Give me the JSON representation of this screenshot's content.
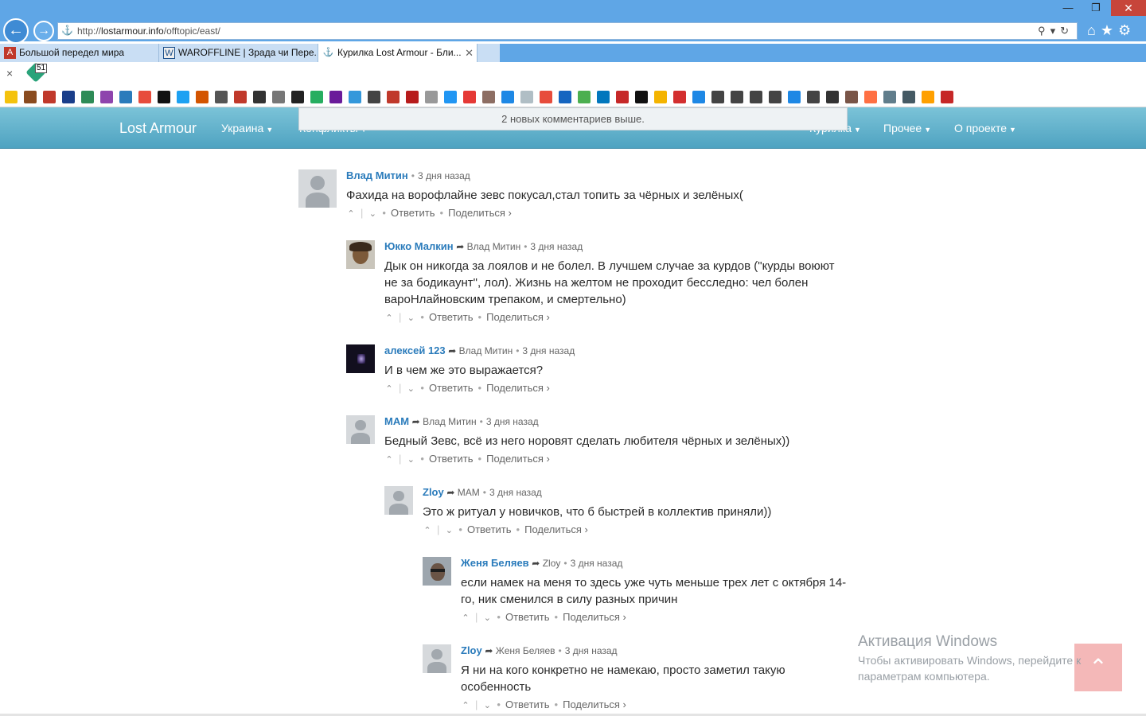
{
  "browser": {
    "url_prefix": "http://",
    "url_domain": "lostarmour.info",
    "url_path": "/offtopic/east/",
    "tabs": [
      {
        "label": "Большой передел мира"
      },
      {
        "label": "WAROFFLINE | Зрада чи Пере..."
      },
      {
        "label": "Курилка Lost Armour - Бли..."
      }
    ],
    "cmd_close": "×",
    "badge_count": "51"
  },
  "colors": {
    "chrome": "#5fa6e6",
    "nav": "#4fa3c1",
    "link": "#2a7bbb"
  },
  "site": {
    "brand": "Lost Armour",
    "nav_items": [
      "Украина",
      "Конфликты",
      "Курилка",
      "Прочее",
      "О проекте"
    ],
    "notification": "2 новых комментариев выше."
  },
  "labels": {
    "reply": "Ответить",
    "share": "Поделиться ›"
  },
  "comments": [
    {
      "author": "Влад Митин",
      "parent": "",
      "time": "3 дня назад",
      "text": "Фахида на ворофлайне зевс покусал,стал топить за чёрных и зелёных(",
      "avatar": "default"
    },
    {
      "author": "Юкко Малкин",
      "parent": "Влад Митин",
      "time": "3 дня назад",
      "text": "Дык он никогда за лоялов и не болел. В лучшем случае за курдов (\"курды воюют не за бодикаунт\", лол). Жизнь на желтом не проходит бесследно: чел болен вароНлайновским трепаком, и смертельно)",
      "avatar": "photo"
    },
    {
      "author": "алексей 123",
      "parent": "Влад Митин",
      "time": "3 дня назад",
      "text": "И в чем же это выражается?",
      "avatar": "photo"
    },
    {
      "author": "МАМ",
      "parent": "Влад Митин",
      "time": "3 дня назад",
      "text": "Бедный Зевс, всё из него норовят сделать любителя чёрных и зелёных))",
      "avatar": "default"
    },
    {
      "author": "Zloy",
      "parent": "МАМ",
      "time": "3 дня назад",
      "text": "Это ж ритуал у новичков, что б быстрей в коллектив приняли))",
      "avatar": "default"
    },
    {
      "author": "Женя Беляев",
      "parent": "Zloy",
      "time": "3 дня назад",
      "text": "если намек на меня то здесь уже чуть меньше трех лет с октября 14-го, ник сменился в силу разных причин",
      "avatar": "photo"
    },
    {
      "author": "Zloy",
      "parent": "Женя Беляев",
      "time": "3 дня назад",
      "text": "Я ни на кого конкретно не намекаю, просто заметил такую особенность",
      "avatar": "default"
    }
  ],
  "windows": {
    "activation_title": "Активация Windows",
    "activation_sub": "Чтобы активировать Windows, перейдите к параметрам компьютера."
  }
}
